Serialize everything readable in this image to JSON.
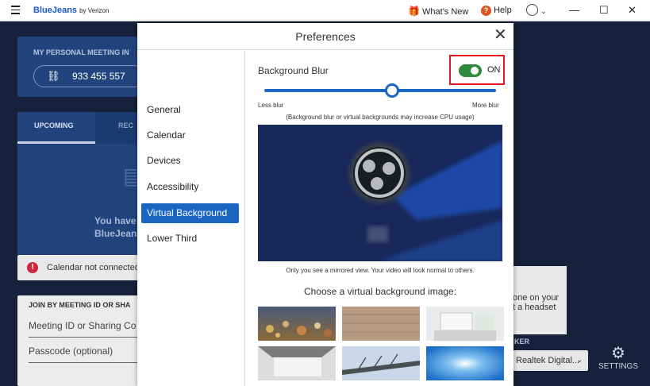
{
  "titlebar": {
    "brand": "BlueJeans",
    "brand_sub": "by Verizon",
    "whats_new": "What's New",
    "help": "Help",
    "minimize": "—",
    "maximize": "☐",
    "close": "✕"
  },
  "background": {
    "personal_meeting_title": "MY PERSONAL MEETING IN",
    "personal_meeting_id": "933 455 557",
    "tab_upcoming": "UPCOMING",
    "tab_recent": "REC",
    "empty_line1": "You have",
    "empty_line2": "BlueJean",
    "calendar_alert": "Calendar not connected",
    "join_title": "JOIN BY MEETING ID OR SHA",
    "meeting_id_placeholder": "Meeting ID or Sharing Co",
    "passcode_placeholder": "Passcode (optional)",
    "right_card_line1": "one on your",
    "right_card_line2": "t a headset",
    "speaker_label": "KER",
    "speaker_value": "Realtek Digital...",
    "settings_label": "SETTINGS"
  },
  "modal": {
    "title": "Preferences",
    "close": "✕",
    "nav": [
      {
        "label": "General"
      },
      {
        "label": "Calendar"
      },
      {
        "label": "Devices"
      },
      {
        "label": "Accessibility"
      },
      {
        "label": "Virtual Background"
      },
      {
        "label": "Lower Third"
      }
    ],
    "active_nav": "Virtual Background",
    "background_blur_label": "Background Blur",
    "blur_toggle_state": "ON",
    "blur_level": 0.55,
    "less_blur": "Less blur",
    "more_blur": "More blur",
    "cpu_note": "(Background blur or virtual backgrounds may increase CPU usage)",
    "mirror_note": "Only you see a mirrored view. Your video will look normal to others.",
    "choose_label": "Choose a virtual background image:"
  },
  "colors": {
    "accent": "#1a65c2",
    "toggle_on": "#2e8b3c",
    "highlight_box": "#e0191f",
    "app_bg": "#16213b"
  }
}
